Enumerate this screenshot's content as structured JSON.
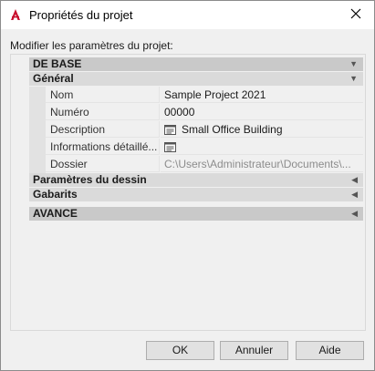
{
  "window": {
    "title": "Propriétés du projet",
    "app_icon": "autocad-a-icon",
    "close_icon": "close-icon"
  },
  "prompt_label": "Modifier les paramètres du projet:",
  "categories": {
    "base": {
      "label": "DE BASE",
      "state": "expanded"
    },
    "general": {
      "label": "Général",
      "state": "expanded"
    },
    "drawing_params": {
      "label": "Paramètres du dessin",
      "state": "collapsed"
    },
    "templates": {
      "label": "Gabarits",
      "state": "collapsed"
    },
    "advanced": {
      "label": "AVANCE",
      "state": "collapsed"
    }
  },
  "properties": {
    "name": {
      "label": "Nom",
      "value": "Sample Project 2021"
    },
    "number": {
      "label": "Numéro",
      "value": "00000"
    },
    "description": {
      "label": "Description",
      "value": "Small Office Building",
      "icon": "text-editor-icon"
    },
    "details": {
      "label": "Informations détaillé...",
      "value": "",
      "icon": "text-editor-icon"
    },
    "folder": {
      "label": "Dossier",
      "value": "C:\\Users\\Administrateur\\Documents\\..."
    }
  },
  "buttons": {
    "ok": "OK",
    "cancel": "Annuler",
    "help": "Aide"
  },
  "colors": {
    "dialog_bg": "#f0f0f0",
    "category_bg": "#dadada",
    "app_icon_red": "#c8102e"
  }
}
